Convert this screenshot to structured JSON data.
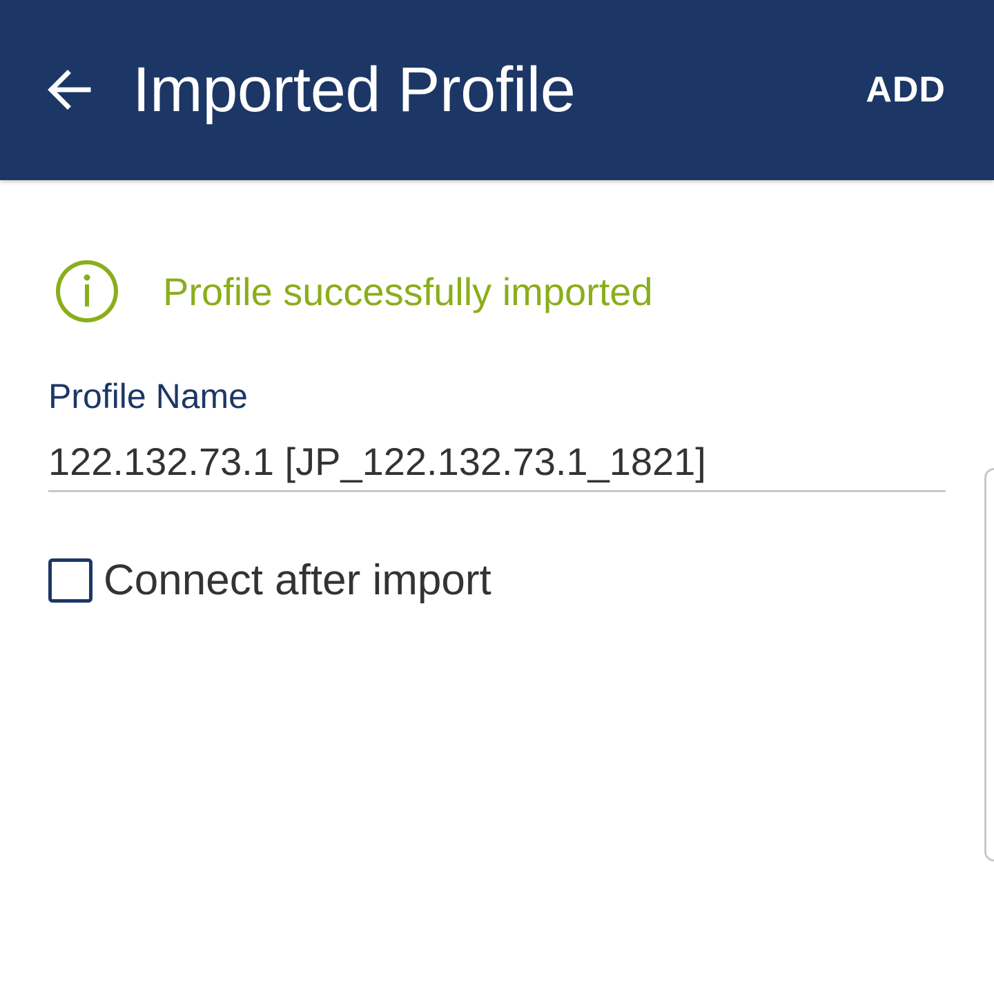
{
  "app_bar": {
    "title": "Imported Profile",
    "add_label": "ADD",
    "back_icon": "arrow-left-icon",
    "background_color": "#1c3766"
  },
  "status": {
    "icon": "info-circle-icon",
    "message": "Profile successfully imported",
    "color": "#8aae1a"
  },
  "profile_name": {
    "label": "Profile Name",
    "value": "122.132.73.1 [JP_122.132.73.1_1821]"
  },
  "connect_after_import": {
    "label": "Connect after import",
    "checked": false
  }
}
